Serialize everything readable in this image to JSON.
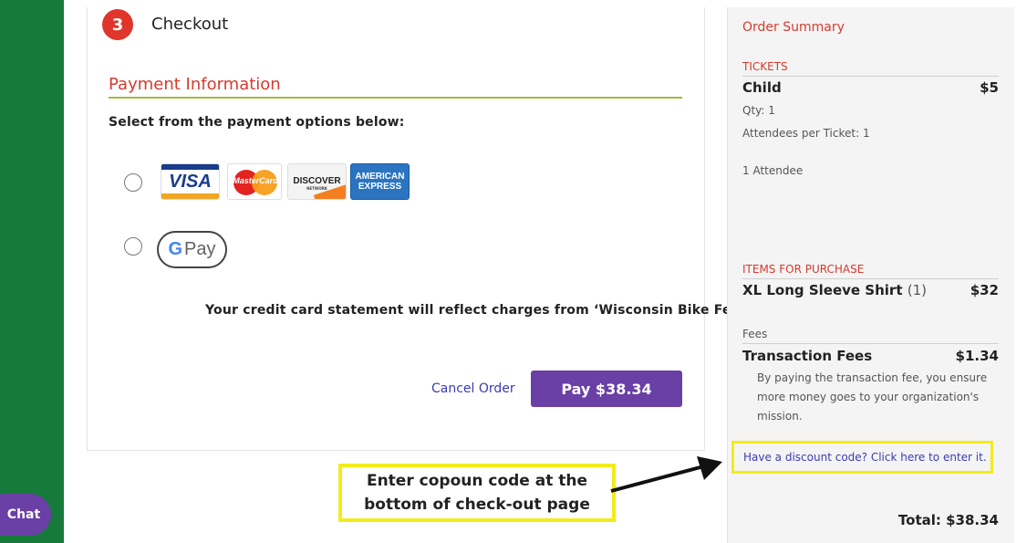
{
  "chat": {
    "label": "Chat"
  },
  "checkout": {
    "step_number": "3",
    "step_title": "Checkout",
    "payment_heading": "Payment Information",
    "instruction": "Select from the payment options below:",
    "card_logos": {
      "visa": "VISA",
      "mastercard": "MasterCard",
      "discover": "DISCOVER",
      "discover_sub": "NETWORK",
      "amex_line1": "AMERICAN",
      "amex_line2": "EXPRESS"
    },
    "gpay_g": "G",
    "gpay_text": "Pay",
    "statement": "Your credit card statement will reflect charges from ‘Wisconsin Bike Fed’",
    "cancel_label": "Cancel Order",
    "pay_label": "Pay $38.34"
  },
  "summary": {
    "title": "Order Summary",
    "tickets_label": "TICKETS",
    "ticket": {
      "name": "Child",
      "price": "$5",
      "qty": "Qty: 1",
      "attendees_per_ticket": "Attendees per Ticket: 1",
      "attendee_count": "1 Attendee"
    },
    "items_label": "ITEMS FOR PURCHASE",
    "item": {
      "name": "XL Long Sleeve Shirt",
      "qty": "(1)",
      "price": "$32"
    },
    "fees_label": "Fees",
    "fee": {
      "name": "Transaction Fees",
      "price": "$1.34",
      "note": "By paying the transaction fee, you ensure more money goes to your organization's mission."
    },
    "discount_link": "Have a discount code? Click here to enter it.",
    "total": "Total:  $38.34"
  },
  "annotation": {
    "callout_text": "Enter copoun code at the bottom of check-out page"
  },
  "colors": {
    "brand_green": "#157a3a",
    "accent_red": "#d63a2e",
    "purple": "#6a3fa6",
    "highlight_yellow": "#f2ec1a"
  }
}
